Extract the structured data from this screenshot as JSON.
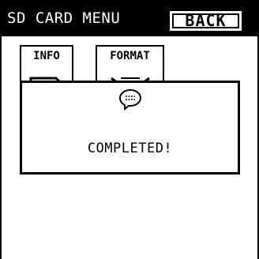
{
  "header": {
    "title": "SD CARD MENU",
    "back_label": "BACK"
  },
  "menu": {
    "items": [
      {
        "label": "INFO",
        "icon": "sd-card-info-icon"
      },
      {
        "label": "FORMAT",
        "icon": "sd-card-format-icon"
      }
    ]
  },
  "dialog": {
    "icon": "speech-bubble-icon",
    "message": "COMPLETED!"
  },
  "colors": {
    "background": "#ffffff",
    "foreground": "#000000"
  }
}
